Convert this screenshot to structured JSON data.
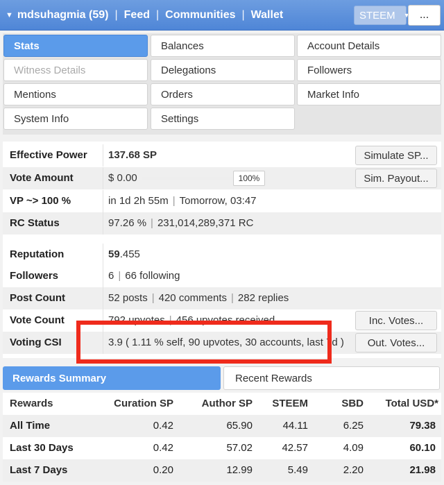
{
  "topbar": {
    "user": "mdsuhagmia (59)",
    "nav": [
      "Feed",
      "Communities",
      "Wallet"
    ],
    "currency": "STEEM",
    "more_label": "..."
  },
  "tabs": [
    "Stats",
    "Balances",
    "Account Details",
    "Witness Details",
    "Delegations",
    "Followers",
    "Mentions",
    "Orders",
    "Market Info",
    "System Info",
    "Settings"
  ],
  "stats": {
    "effective_power": {
      "label": "Effective Power",
      "value": "137.68 SP",
      "button": "Simulate SP..."
    },
    "vote_amount": {
      "label": "Vote Amount",
      "value": "$ 0.00",
      "percent": "100%",
      "button": "Sim. Payout..."
    },
    "vp": {
      "label": "VP ~> 100 %",
      "time": "in 1d 2h 55m",
      "when": "Tomorrow, 03:47"
    },
    "rc": {
      "label": "RC Status",
      "percent": "97.26 %",
      "amount": "231,014,289,371 RC"
    },
    "reputation": {
      "label": "Reputation",
      "int": "59",
      "dec": ".455"
    },
    "followers": {
      "label": "Followers",
      "count": "6",
      "following": "66 following"
    },
    "post_count": {
      "label": "Post Count",
      "posts": "52 posts",
      "comments": "420 comments",
      "replies": "282 replies"
    },
    "vote_count": {
      "label": "Vote Count",
      "upvotes": "792 upvotes",
      "received": "456 upvotes received",
      "button": "Inc. Votes..."
    },
    "voting_csi": {
      "label": "Voting CSI",
      "value": "3.9 ( 1.11 % self, 90 upvotes, 30 accounts, last 7d )",
      "button": "Out. Votes..."
    }
  },
  "rewards_tabs": {
    "summary": "Rewards Summary",
    "recent": "Recent Rewards"
  },
  "rewards": {
    "headers": [
      "Rewards",
      "Curation SP",
      "Author SP",
      "STEEM",
      "SBD",
      "Total USD*"
    ],
    "rows": [
      [
        "All Time",
        "0.42",
        "65.90",
        "44.11",
        "6.25",
        "79.38"
      ],
      [
        "Last 30 Days",
        "0.42",
        "57.02",
        "42.57",
        "4.09",
        "60.10"
      ],
      [
        "Last 7 Days",
        "0.20",
        "12.99",
        "5.49",
        "2.20",
        "21.98"
      ]
    ]
  },
  "colors": {
    "accent": "#5b9bea",
    "topbar": "#4f86d7",
    "highlight": "#ef2b1c"
  }
}
